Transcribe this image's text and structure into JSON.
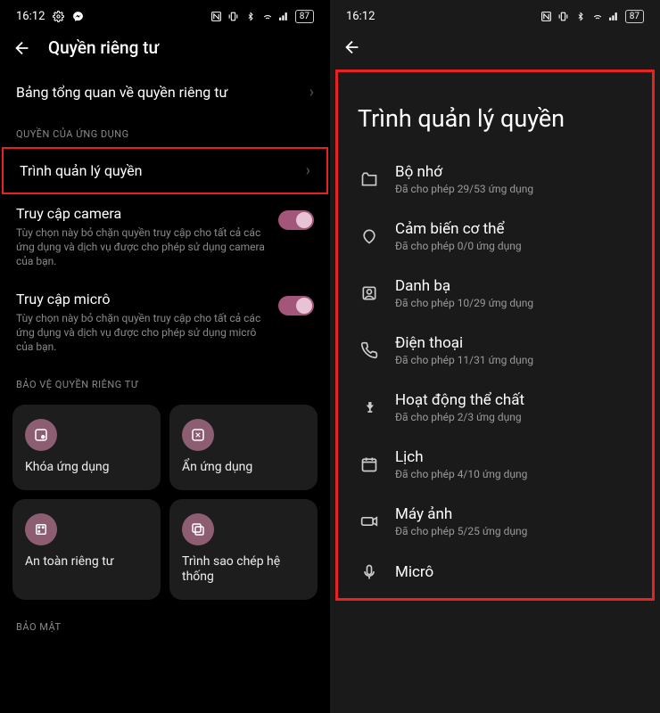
{
  "statusbar": {
    "time": "16:12",
    "battery": "87"
  },
  "screen1": {
    "title": "Quyền riêng tư",
    "overview": "Bảng tổng quan về quyền riêng tư",
    "section_app_perm": "QUYỀN CỦA ỨNG DỤNG",
    "perm_manager": "Trình quản lý quyền",
    "camera": {
      "title": "Truy cập camera",
      "desc": "Tùy chọn này bỏ chặn quyền truy cập cho tất cả các ứng dụng và dịch vụ được cho phép sử dụng camera của bạn."
    },
    "mic": {
      "title": "Truy cập micrô",
      "desc": "Tùy chọn này bỏ chặn quyền truy cập cho tất cả các ứng dụng và dịch vụ được cho phép sử dụng micrô của bạn."
    },
    "section_protect": "BẢO VỆ QUYỀN RIÊNG TƯ",
    "tiles": {
      "lock": "Khóa ứng dụng",
      "hide": "Ẩn ứng dụng",
      "safe": "An toàn riêng tư",
      "clip": "Trình sao chép hệ thống"
    },
    "section_security": "BẢO MẬT"
  },
  "screen2": {
    "title": "Trình quản lý quyền",
    "items": [
      {
        "name": "Bộ nhớ",
        "sub": "Đã cho phép 29/53 ứng dụng"
      },
      {
        "name": "Cảm biến cơ thể",
        "sub": "Đã cho phép 0/0 ứng dụng"
      },
      {
        "name": "Danh bạ",
        "sub": "Đã cho phép 10/29 ứng dụng"
      },
      {
        "name": "Điện thoại",
        "sub": "Đã cho phép 11/31 ứng dụng"
      },
      {
        "name": "Hoạt động thể chất",
        "sub": "Đã cho phép 2/3 ứng dụng"
      },
      {
        "name": "Lịch",
        "sub": "Đã cho phép 4/10 ứng dụng"
      },
      {
        "name": "Máy ảnh",
        "sub": "Đã cho phép 5/25 ứng dụng"
      },
      {
        "name": "Micrô",
        "sub": ""
      }
    ]
  }
}
